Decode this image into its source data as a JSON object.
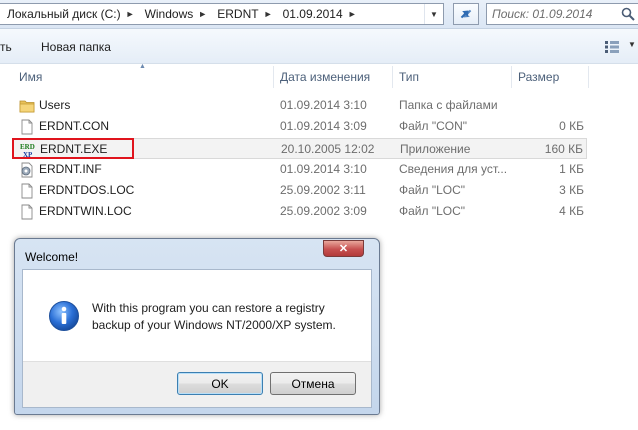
{
  "address": {
    "crumbs": [
      "Локальный диск (C:)",
      "Windows",
      "ERDNT",
      "01.09.2014"
    ]
  },
  "search": {
    "placeholder": "Поиск: 01.09.2014"
  },
  "toolbar": {
    "left_fragment": "ть",
    "new_folder": "Новая папка"
  },
  "columns": {
    "name": "Имя",
    "date": "Дата изменения",
    "type": "Тип",
    "size": "Размер"
  },
  "files": [
    {
      "name": "Users",
      "date": "01.09.2014 3:10",
      "type": "Папка с файлами",
      "size": "",
      "icon": "folder-icon"
    },
    {
      "name": "ERDNT.CON",
      "date": "01.09.2014 3:09",
      "type": "Файл \"CON\"",
      "size": "0 КБ",
      "icon": "file-icon"
    },
    {
      "name": "ERDNT.EXE",
      "date": "20.10.2005 12:02",
      "type": "Приложение",
      "size": "160 КБ",
      "icon": "erd-app-icon"
    },
    {
      "name": "ERDNT.INF",
      "date": "01.09.2014 3:10",
      "type": "Сведения для уст...",
      "size": "1 КБ",
      "icon": "setup-info-icon"
    },
    {
      "name": "ERDNTDOS.LOC",
      "date": "25.09.2002 3:11",
      "type": "Файл \"LOC\"",
      "size": "3 КБ",
      "icon": "file-icon"
    },
    {
      "name": "ERDNTWIN.LOC",
      "date": "25.09.2002 3:09",
      "type": "Файл \"LOC\"",
      "size": "4 КБ",
      "icon": "file-icon"
    }
  ],
  "dialog": {
    "title": "Welcome!",
    "message": "With this program you can restore a registry backup of your Windows NT/2000/XP system.",
    "ok_label": "OK",
    "cancel_label": "Отмена",
    "icon": "info-icon"
  },
  "colors": {
    "highlight": "#e0141d",
    "accent": "#3c7fb1"
  }
}
